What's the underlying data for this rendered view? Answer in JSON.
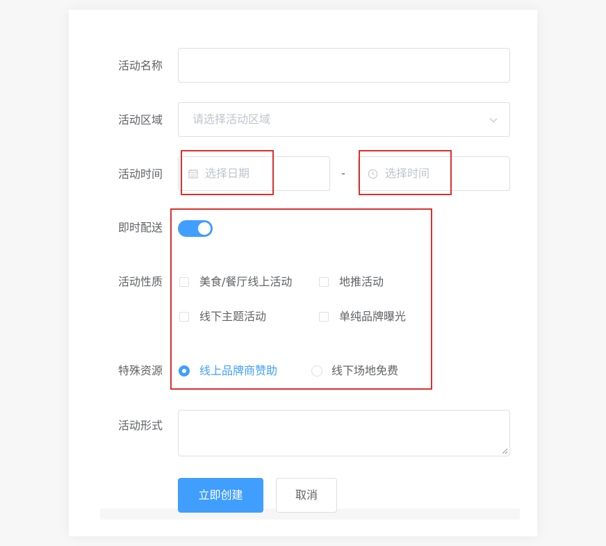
{
  "form": {
    "name": {
      "label": "活动名称",
      "value": ""
    },
    "region": {
      "label": "活动区域",
      "placeholder": "请选择活动区域"
    },
    "time": {
      "label": "活动时间",
      "date_placeholder": "选择日期",
      "separator": "-",
      "time_placeholder": "选择时间"
    },
    "delivery": {
      "label": "即时配送",
      "enabled": true
    },
    "nature": {
      "label": "活动性质",
      "options": [
        {
          "label": "美食/餐厅线上活动",
          "checked": false
        },
        {
          "label": "地推活动",
          "checked": false
        },
        {
          "label": "线下主题活动",
          "checked": false
        },
        {
          "label": "单纯品牌曝光",
          "checked": false
        }
      ]
    },
    "resource": {
      "label": "特殊资源",
      "options": [
        {
          "label": "线上品牌商赞助",
          "checked": true
        },
        {
          "label": "线下场地免费",
          "checked": false
        }
      ]
    },
    "form_desc": {
      "label": "活动形式",
      "value": ""
    }
  },
  "actions": {
    "create_label": "立即创建",
    "cancel_label": "取消"
  },
  "colors": {
    "primary": "#409eff",
    "highlight": "#d9302c",
    "border": "#dcdfe6",
    "text": "#606266",
    "placeholder": "#c0c4cc"
  },
  "icons": {
    "date": "calendar-icon",
    "time": "clock-icon",
    "select": "chevron-down-icon",
    "textarea": "resize-handle-icon"
  }
}
